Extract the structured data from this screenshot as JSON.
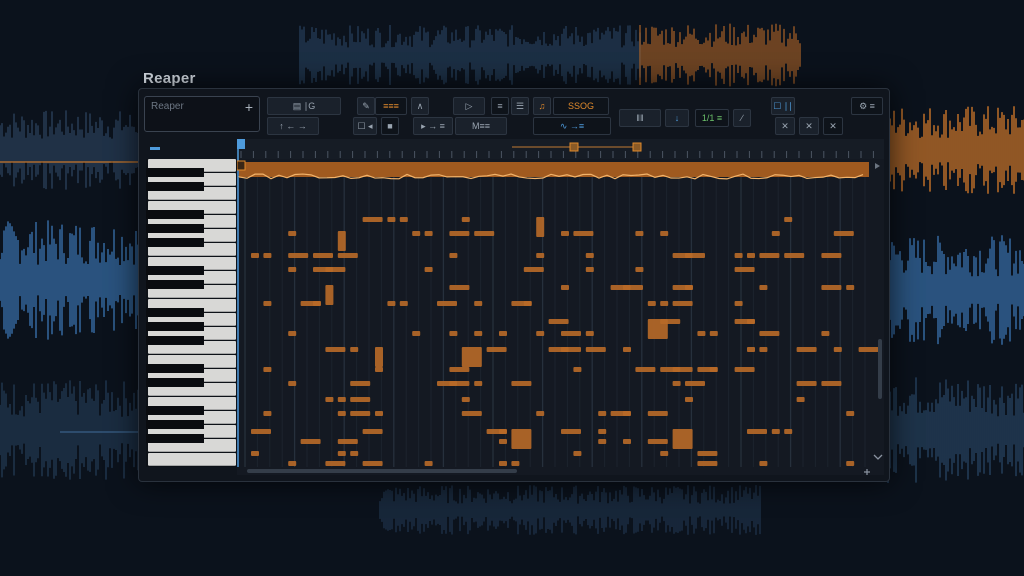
{
  "app": {
    "title": "Reaper"
  },
  "toolbar": {
    "search_placeholder": "Reaper",
    "search_add": "+",
    "row1": [
      {
        "name": "tool-button-snap",
        "label": "▤ ∣G"
      },
      {
        "name": "tool-button-pencil",
        "label": "✎"
      },
      {
        "name": "tool-button-orange-1",
        "label": "≡≡≡",
        "tone": "orange"
      },
      {
        "name": "tool-button-curve",
        "label": "∧"
      },
      {
        "name": "tool-button-play",
        "label": "▷"
      },
      {
        "name": "tool-button-eq",
        "label": "≡"
      },
      {
        "name": "tool-button-list",
        "label": "☰"
      },
      {
        "name": "tool-button-midi",
        "label": "♫",
        "tone": "orange"
      },
      {
        "name": "tool-button-value",
        "label": "SSOG",
        "tone": "orange"
      },
      {
        "name": "tool-button-mixer",
        "label": "‖‖"
      },
      {
        "name": "tool-button-arrow",
        "label": "↓",
        "tone": "blue"
      },
      {
        "name": "tool-button-green",
        "label": "1/1 ≡",
        "tone": "green"
      },
      {
        "name": "tool-button-brush",
        "label": "∕"
      },
      {
        "name": "tool-button-view",
        "label": "☐ ∣∣",
        "tone": "blue"
      },
      {
        "name": "tool-button-settings",
        "label": "⚙ ≡"
      }
    ],
    "row2": [
      {
        "name": "tool-button-cursor",
        "label": "↑ ← →"
      },
      {
        "name": "tool-button-select",
        "label": "☐ ◂"
      },
      {
        "name": "tool-button-block",
        "label": "■"
      },
      {
        "name": "tool-button-next",
        "label": "▸ → ≡"
      },
      {
        "name": "tool-button-grid",
        "label": "M≡≡"
      },
      {
        "name": "tool-button-wave",
        "label": "∿ →≡",
        "tone": "blue"
      },
      {
        "name": "tool-button-close-1",
        "label": "✕"
      },
      {
        "name": "tool-button-close-2",
        "label": "✕"
      },
      {
        "name": "tool-button-close-3",
        "label": "✕"
      }
    ]
  },
  "colors": {
    "accent_orange": "#e08a2c",
    "accent_blue": "#4e9bdc",
    "background": "#0b121c",
    "window": "#10151d",
    "roll_bg": "#141922",
    "note_orange": "#c0702a"
  },
  "icons": [
    "plus-icon",
    "pencil-icon",
    "play-icon",
    "close-icon",
    "scroll-up-icon",
    "scroll-down-icon",
    "scroll-right-icon"
  ]
}
